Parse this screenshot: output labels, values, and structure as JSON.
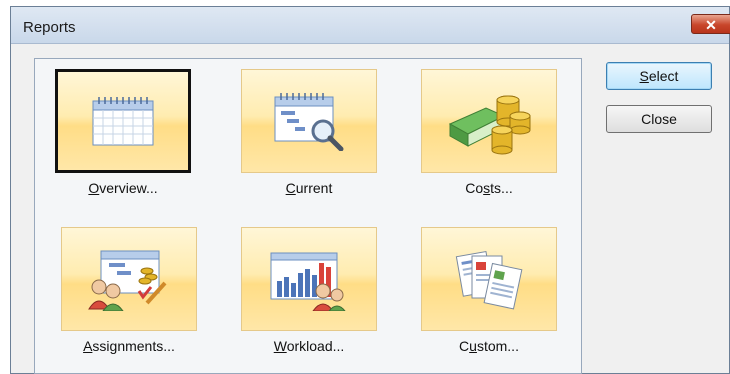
{
  "window": {
    "title": "Reports",
    "close_glyph": "✕"
  },
  "tiles": [
    {
      "label_before": "",
      "label_mnemonic": "O",
      "label_after": "verview...",
      "icon": "calendar-grid-icon",
      "selected": true
    },
    {
      "label_before": "",
      "label_mnemonic": "C",
      "label_after": "urrent",
      "icon": "calendar-search-icon",
      "selected": false
    },
    {
      "label_before": "Co",
      "label_mnemonic": "s",
      "label_after": "ts...",
      "icon": "money-coins-icon",
      "selected": false
    },
    {
      "label_before": "",
      "label_mnemonic": "A",
      "label_after": "ssignments...",
      "icon": "assignments-people-icon",
      "selected": false
    },
    {
      "label_before": "",
      "label_mnemonic": "W",
      "label_after": "orkload...",
      "icon": "workload-chart-icon",
      "selected": false
    },
    {
      "label_before": "C",
      "label_mnemonic": "u",
      "label_after": "stom...",
      "icon": "custom-documents-icon",
      "selected": false
    }
  ],
  "buttons": {
    "select": {
      "label_before": "",
      "label_mnemonic": "S",
      "label_after": "elect"
    },
    "close": {
      "label": "Close"
    }
  },
  "colors": {
    "tile_gradient_top": "#fff6d7",
    "tile_gradient_bottom": "#ffdd86",
    "title_bar": "#c9d8ea",
    "close_red": "#c8462b"
  }
}
